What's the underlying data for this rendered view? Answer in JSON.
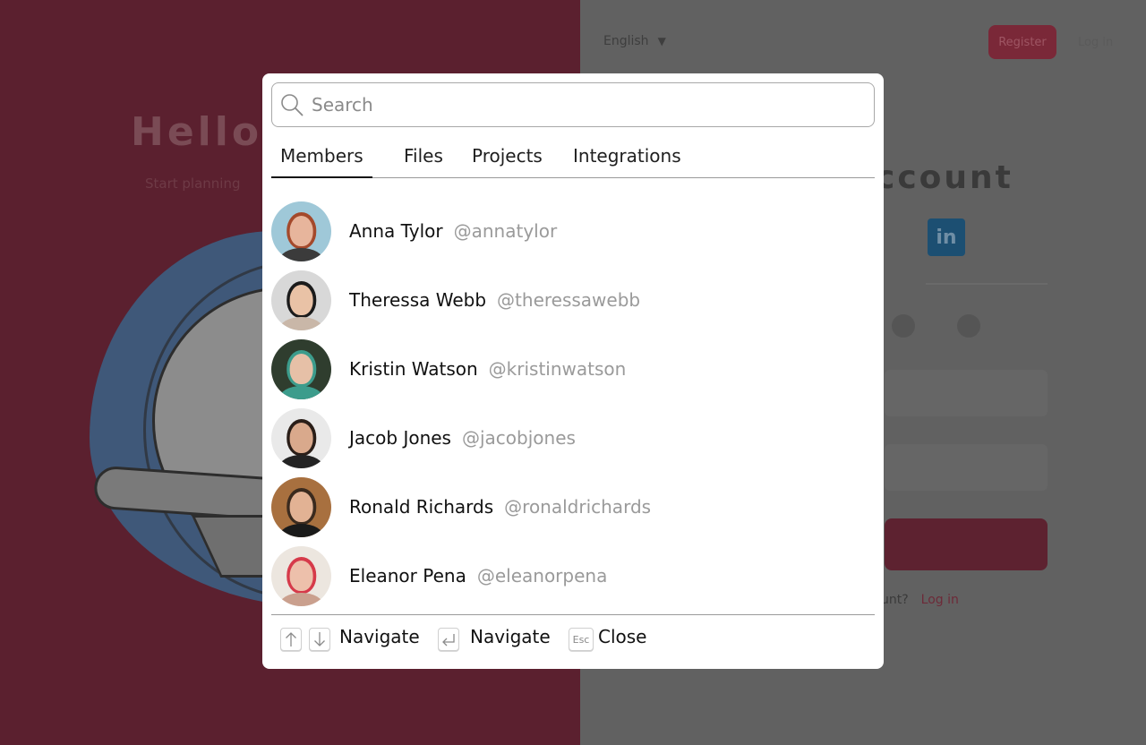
{
  "background": {
    "language": "English",
    "register_label": "Register",
    "login_label": "Log in",
    "hello": "Hello,",
    "subtitle": "Start planning",
    "account_heading": "ccount",
    "linkedin": "in",
    "question": "unt?",
    "question_link": "Log in"
  },
  "search": {
    "placeholder": "Search",
    "value": ""
  },
  "tabs": [
    {
      "label": "Members",
      "active": true
    },
    {
      "label": "Files",
      "active": false
    },
    {
      "label": "Projects",
      "active": false
    },
    {
      "label": "Integrations",
      "active": false
    }
  ],
  "members": [
    {
      "name": "Anna Tylor",
      "handle": "@annatylor",
      "avatar_bg": "#9fc8d8",
      "skin": "#e7b59c",
      "hair": "#a4492b",
      "shirt": "#3b3b3b"
    },
    {
      "name": "Theressa Webb",
      "handle": "@theressawebb",
      "avatar_bg": "#d8d8d8",
      "skin": "#e9c2a6",
      "hair": "#1b1b1b",
      "shirt": "#c9b7a8"
    },
    {
      "name": "Kristin Watson",
      "handle": "@kristinwatson",
      "avatar_bg": "#2f3d2e",
      "skin": "#e6c0a7",
      "hair": "#3c9c8c",
      "shirt": "#3c9c8c"
    },
    {
      "name": "Jacob Jones",
      "handle": "@jacobjones",
      "avatar_bg": "#e9e9e9",
      "skin": "#d9a98c",
      "hair": "#2a1e18",
      "shirt": "#232323"
    },
    {
      "name": "Ronald Richards",
      "handle": "@ronaldrichards",
      "avatar_bg": "#a8703f",
      "skin": "#e2b294",
      "hair": "#3a2a1e",
      "shirt": "#1a1a1a"
    },
    {
      "name": "Eleanor Pena",
      "handle": "@eleanorpena",
      "avatar_bg": "#ece6df",
      "skin": "#edc0ab",
      "hair": "#d63a4a",
      "shirt": "#caa08e"
    }
  ],
  "footer": {
    "navigate_label": "Navigate",
    "select_label": "Navigate",
    "esc_key": "Esc",
    "close_label": "Close"
  },
  "colors": {
    "accent": "#d4234a",
    "overlay_left": "#5b202f",
    "overlay_right": "#616161"
  }
}
